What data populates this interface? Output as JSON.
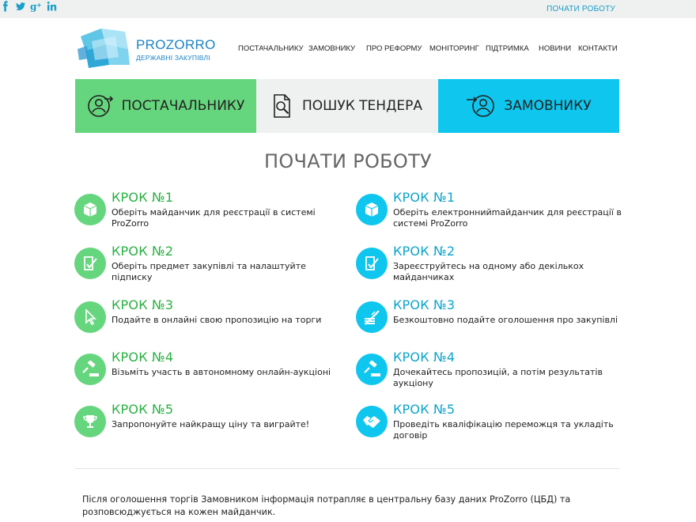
{
  "topbar": {
    "social": [
      {
        "name": "facebook-icon",
        "glyph": "f"
      },
      {
        "name": "twitter-icon",
        "glyph": "t"
      },
      {
        "name": "google-plus-icon",
        "glyph": "g+"
      },
      {
        "name": "linkedin-icon",
        "glyph": "in"
      }
    ],
    "start_link": "ПОЧАТИ РОБОТУ"
  },
  "logo": {
    "wordmark": "PROZORRO",
    "subtitle": "ДЕРЖАВНІ ЗАКУПІВЛІ"
  },
  "nav": {
    "items": [
      "ПОСТАЧАЛЬНИКУ",
      "ЗАМОВНИКУ",
      "ПРО РЕФОРМУ",
      "МОНІТОРИНГ",
      "ПІДТРИМКА",
      "НОВИНИ",
      "КОНТАКТИ"
    ]
  },
  "tabs": [
    {
      "label": "ПОСТАЧАЛЬНИКУ",
      "icon": "user-arrow-icon",
      "color": "#66d67e"
    },
    {
      "label": "ПОШУК ТЕНДЕРА",
      "icon": "document-search-icon",
      "color": "#eef1f0"
    },
    {
      "label": "ЗАМОВНИКУ",
      "icon": "user-arrow-in-icon",
      "color": "#0fc6ee"
    }
  ],
  "section_title": "ПОЧАТИ РОБОТУ",
  "supplier_steps": [
    {
      "title": "КРОК №1",
      "text": "Оберіть майданчик для реєстрації в системі ProZorro",
      "icon": "cube-icon"
    },
    {
      "title": "КРОК №2",
      "text": "Оберіть предмет закупівлі та налаштуйте підписку",
      "icon": "document-check-icon"
    },
    {
      "title": "КРОК №3",
      "text": "Подайте в онлайні свою пропозицію на торги",
      "icon": "cursor-icon"
    },
    {
      "title": "КРОК №4",
      "text": "Візьміть участь в автономному онлайн-аукціоні",
      "icon": "gavel-icon"
    },
    {
      "title": "КРОК №5",
      "text": "Запропонуйте найкращу ціну та виграйте!",
      "icon": "trophy-icon"
    }
  ],
  "customer_steps": [
    {
      "title": "КРОК №1",
      "text": "Оберіть електроннийmайданчик для реєстрації в системі ProZorro",
      "icon": "cube-icon"
    },
    {
      "title": "КРОК №2",
      "text": "Зареєструйтесь на одному або декількох майданчиках",
      "icon": "document-check-icon"
    },
    {
      "title": "КРОК №3",
      "text": "Безкоштовно подайте оголошення про закупівлі",
      "icon": "money-crossed-icon"
    },
    {
      "title": "КРОК №4",
      "text": "Дочекайтесь пропозицій, а потім результатів аукціону",
      "icon": "gavel-icon"
    },
    {
      "title": "КРОК №5",
      "text": "Проведіть кваліфікацію переможця та укладіть договір",
      "icon": "handshake-icon"
    }
  ],
  "info_text": "Після оголошення торгів Замовником інформація потрапляє в центральну базу даних ProZorro (ЦБД) та розповсюджується на кожен майданчик."
}
